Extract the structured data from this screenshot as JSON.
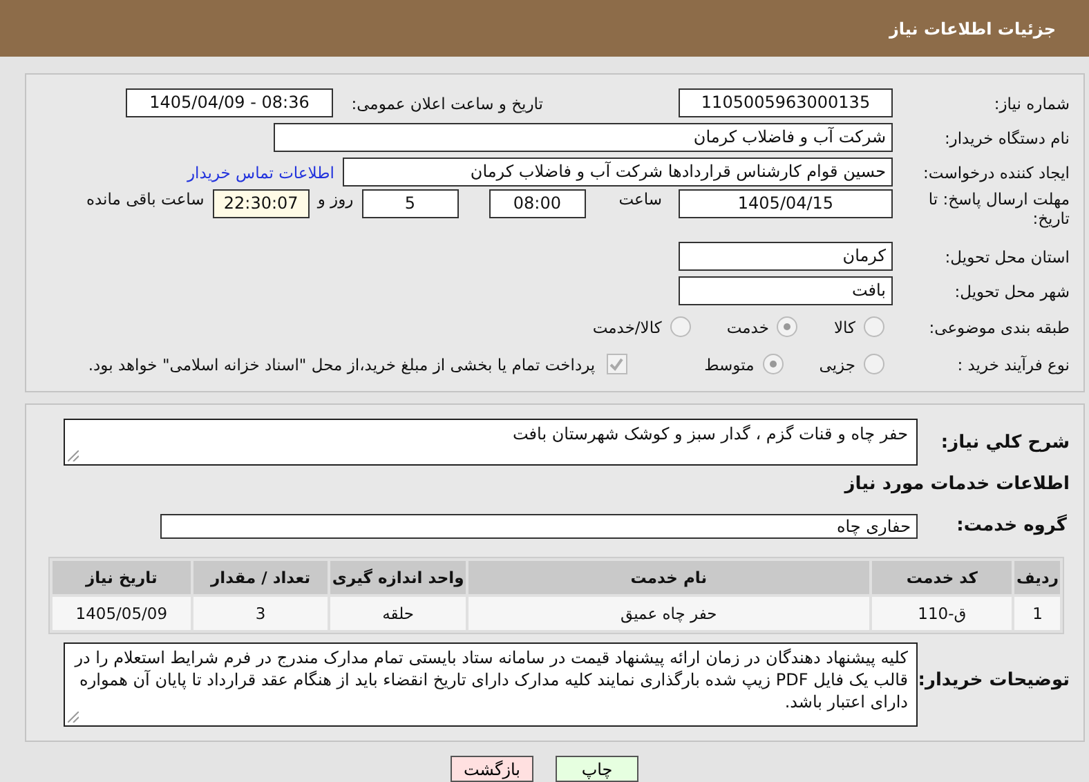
{
  "header": {
    "title": "جزئیات اطلاعات نیاز"
  },
  "details": {
    "need_number": {
      "label": "شماره نیاز:",
      "value": "1105005963000135"
    },
    "announce": {
      "label": "تاریخ و ساعت اعلان عمومی:",
      "value": "1405/04/09 - 08:36"
    },
    "buyer_org": {
      "label": "نام دستگاه خریدار:",
      "value": "شرکت آب و فاضلاب کرمان"
    },
    "requester": {
      "label": "ایجاد کننده درخواست:",
      "value": "حسین قوام کارشناس قراردادها شرکت آب و فاضلاب کرمان",
      "link": "اطلاعات تماس خریدار"
    },
    "deadline": {
      "label": "مهلت ارسال پاسخ: تا تاریخ:",
      "date": "1405/04/15",
      "time_label": "ساعت",
      "time": "08:00",
      "days": "5",
      "days_label": "روز و",
      "remaining": "22:30:07",
      "remaining_label": "ساعت باقی مانده"
    },
    "province": {
      "label": "استان محل تحویل:",
      "value": "کرمان"
    },
    "city": {
      "label": "شهر محل تحویل:",
      "value": "بافت"
    },
    "category": {
      "label": "طبقه بندی موضوعی:",
      "options": [
        {
          "label": "کالا",
          "selected": false
        },
        {
          "label": "خدمت",
          "selected": true
        },
        {
          "label": "کالا/خدمت",
          "selected": false
        }
      ]
    },
    "purchase_type": {
      "label": "نوع فرآیند خرید :",
      "options": [
        {
          "label": "جزیی",
          "selected": false
        },
        {
          "label": "متوسط",
          "selected": true
        }
      ],
      "payment_note": {
        "checked": true,
        "text": "پرداخت تمام یا بخشی از مبلغ خرید،از محل \"اسناد خزانه اسلامی\" خواهد بود."
      }
    }
  },
  "services": {
    "description": {
      "label": "شرح کلي نیاز:",
      "value": "حفر چاه و قنات گزم ، گدار سبز و کوشک شهرستان بافت"
    },
    "section_title": "اطلاعات خدمات مورد نیاز",
    "service_group": {
      "label": "گروه خدمت:",
      "value": "حفاری چاه"
    },
    "table": {
      "columns": [
        "ردیف",
        "کد خدمت",
        "نام خدمت",
        "واحد اندازه گیری",
        "تعداد / مقدار",
        "تاریخ نیاز"
      ],
      "rows": [
        [
          "1",
          "ق-110",
          "حفر چاه عمیق",
          "حلقه",
          "3",
          "1405/05/09"
        ]
      ]
    },
    "buyer_notes": {
      "label": "توضیحات خریدار:",
      "value": "کلیه پیشنهاد دهندگان در زمان ارائه پیشنهاد قیمت در سامانه ستاد بایستی تمام مدارک مندرج در فرم شرایط استعلام را در قالب یک فایل PDF زیپ شده بارگذاری نمایند کلیه مدارک دارای تاریخ انقضاء باید از هنگام عقد قرارداد تا پایان آن همواره دارای اعتبار باشد."
    }
  },
  "buttons": [
    {
      "label": "چاپ",
      "kind": "print"
    },
    {
      "label": "بازگشت",
      "kind": "back"
    }
  ]
}
